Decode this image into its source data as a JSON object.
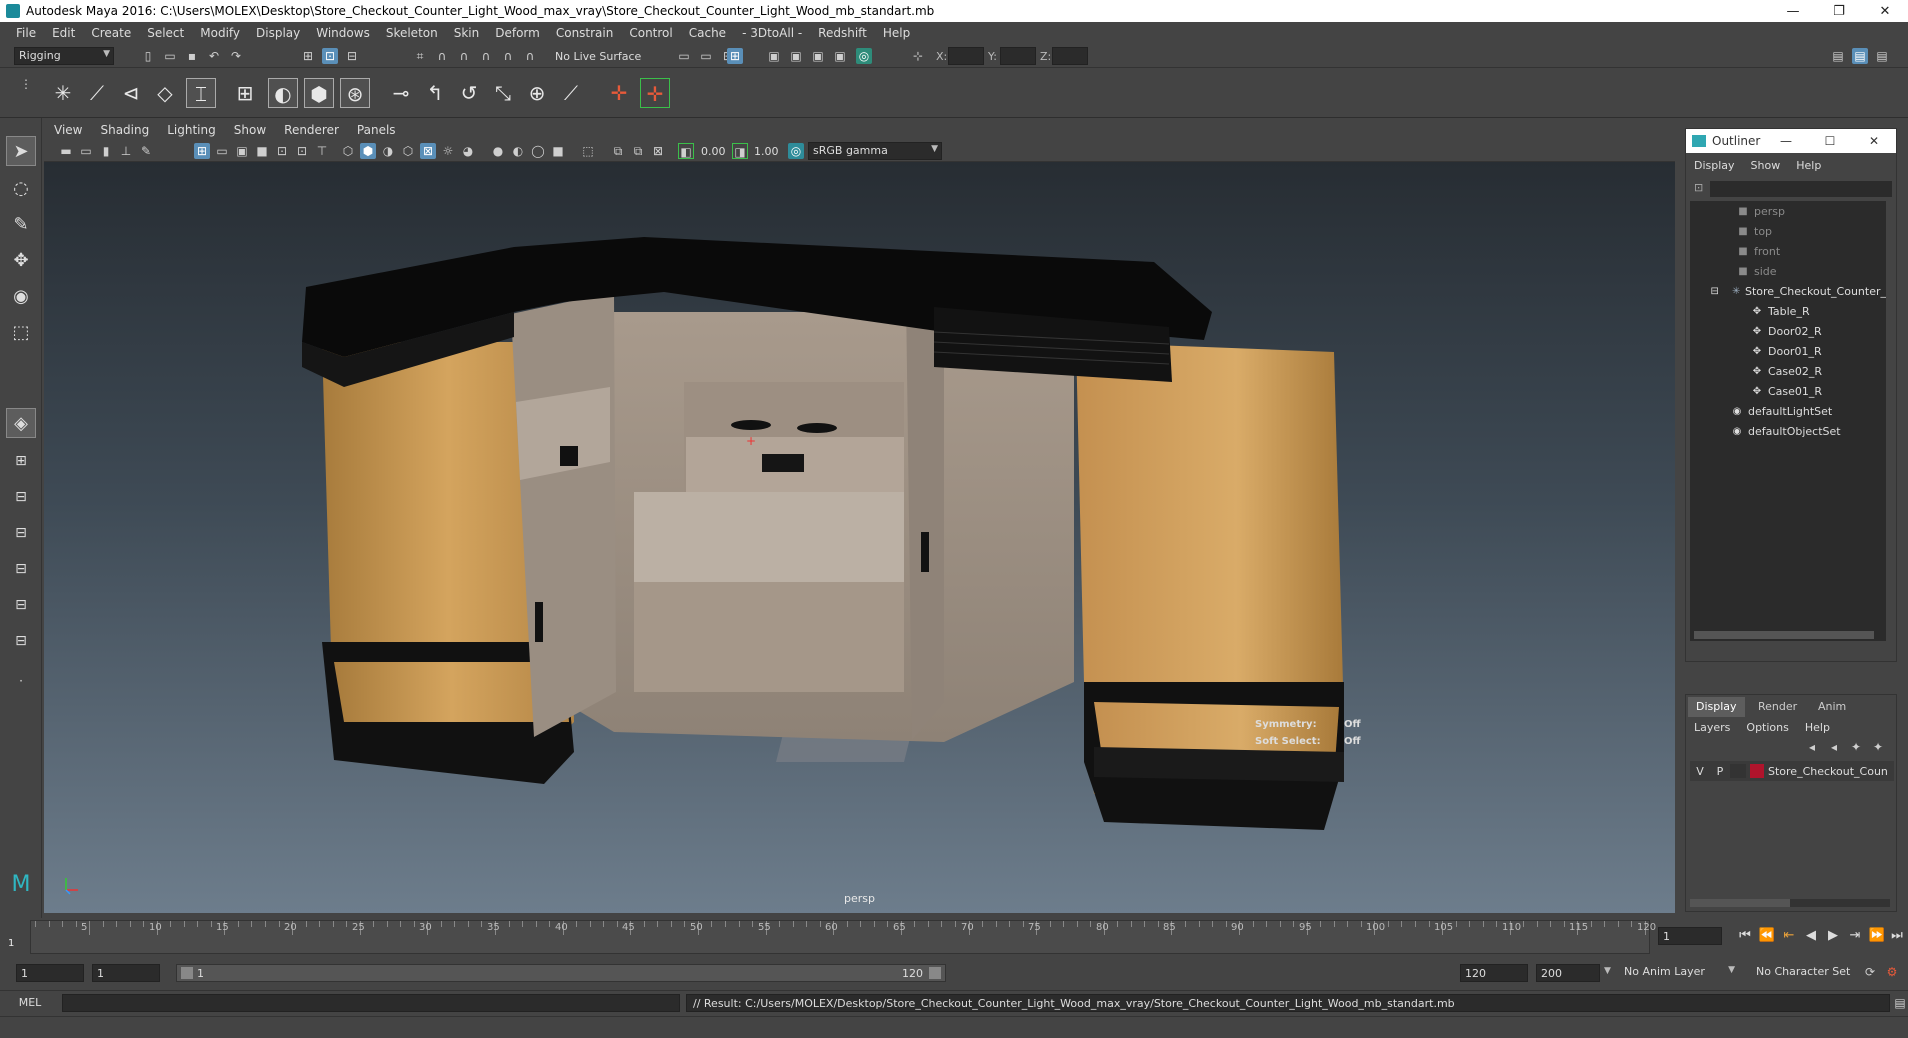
{
  "window": {
    "title": "Autodesk Maya 2016: C:\\Users\\MOLEX\\Desktop\\Store_Checkout_Counter_Light_Wood_max_vray\\Store_Checkout_Counter_Light_Wood_mb_standart.mb",
    "minimize": "—",
    "restore": "❐",
    "close": "✕"
  },
  "menubar": [
    "File",
    "Edit",
    "Create",
    "Select",
    "Modify",
    "Display",
    "Windows",
    "Skeleton",
    "Skin",
    "Deform",
    "Constrain",
    "Control",
    "Cache",
    "- 3DtoAll -",
    "Redshift",
    "Help"
  ],
  "statusline": {
    "mode": "Rigging",
    "live_surface": "No Live Surface",
    "x_label": "X:",
    "y_label": "Y:",
    "z_label": "Z:"
  },
  "viewport": {
    "menu": [
      "View",
      "Shading",
      "Lighting",
      "Show",
      "Renderer",
      "Panels"
    ],
    "near_value": "0.00",
    "far_value": "1.00",
    "color_space": "sRGB gamma",
    "camera_label": "persp",
    "hud": {
      "symmetry_label": "Symmetry:",
      "symmetry_value": "Off",
      "soft_select_label": "Soft Select:",
      "soft_select_value": "Off"
    }
  },
  "outliner": {
    "title": "Outliner",
    "menu": [
      "Display",
      "Show",
      "Help"
    ],
    "items": [
      {
        "label": "persp",
        "dim": true,
        "indent": 1
      },
      {
        "label": "top",
        "dim": true,
        "indent": 1
      },
      {
        "label": "front",
        "dim": true,
        "indent": 1
      },
      {
        "label": "side",
        "dim": true,
        "indent": 1
      },
      {
        "label": "Store_Checkout_Counter_",
        "dim": false,
        "indent": 1
      },
      {
        "label": "Table_R",
        "dim": false,
        "indent": 2
      },
      {
        "label": "Door02_R",
        "dim": false,
        "indent": 2
      },
      {
        "label": "Door01_R",
        "dim": false,
        "indent": 2
      },
      {
        "label": "Case02_R",
        "dim": false,
        "indent": 2
      },
      {
        "label": "Case01_R",
        "dim": false,
        "indent": 2
      },
      {
        "label": "defaultLightSet",
        "dim": false,
        "indent": 1
      },
      {
        "label": "defaultObjectSet",
        "dim": false,
        "indent": 1
      }
    ]
  },
  "layers": {
    "tabs": [
      "Display",
      "Render",
      "Anim"
    ],
    "menu": [
      "Layers",
      "Options",
      "Help"
    ],
    "layer": {
      "v": "V",
      "p": "P",
      "name": "Store_Checkout_Coun",
      "color": "#b0142c"
    }
  },
  "timeslider": {
    "ticks": [
      "5",
      "10",
      "15",
      "20",
      "25",
      "30",
      "35",
      "40",
      "45",
      "50",
      "55",
      "60",
      "65",
      "70",
      "75",
      "80",
      "85",
      "90",
      "95",
      "100",
      "105",
      "110",
      "115",
      "120"
    ],
    "start_label": "1",
    "current_frame": "1"
  },
  "rangeslider": {
    "start": "1",
    "playback_start": "1",
    "range_start": "1",
    "range_end": "120",
    "playback_end": "120",
    "end": "200",
    "anim_layer": "No Anim Layer",
    "char_set": "No Character Set"
  },
  "cmdline": {
    "lang": "MEL",
    "result": "// Result: C:/Users/MOLEX/Desktop/Store_Checkout_Counter_Light_Wood_max_vray/Store_Checkout_Counter_Light_Wood_mb_standart.mb"
  }
}
